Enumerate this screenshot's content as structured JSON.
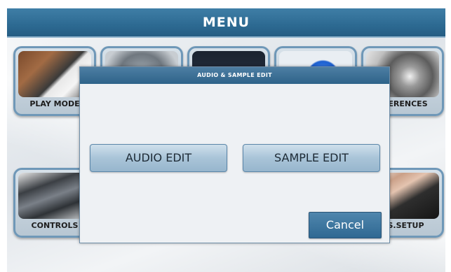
{
  "header": {
    "title": "MENU"
  },
  "tiles": {
    "top": [
      {
        "label": "PLAY MODE"
      },
      {
        "label": ""
      },
      {
        "label": ""
      },
      {
        "label": ""
      },
      {
        "label": "EFERENCES"
      }
    ],
    "bottom": [
      {
        "label": "CONTROLS"
      },
      {
        "label": "GS.SETUP"
      }
    ]
  },
  "dialog": {
    "title": "AUDIO & SAMPLE EDIT",
    "buttons": {
      "audio_edit": "AUDIO EDIT",
      "sample_edit": "SAMPLE EDIT",
      "cancel": "Cancel"
    }
  },
  "colors": {
    "accent": "#2d6a92",
    "button_light": "#a9c4d8",
    "cancel_button": "#2f6892"
  }
}
